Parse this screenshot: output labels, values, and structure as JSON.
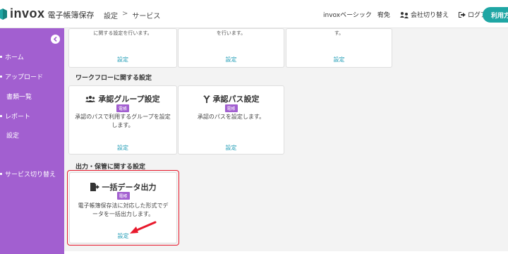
{
  "header": {
    "logo_text": "invox",
    "logo_sub": "電子帳簿保存",
    "breadcrumb": [
      "設定",
      "サービス"
    ],
    "breadcrumb_sep": ">",
    "plan": "invoxベーシック",
    "user": "宥免",
    "switch_company": "会社切り替え",
    "logout": "ログアウト",
    "use_button": "利用方法"
  },
  "sidebar": {
    "items": [
      {
        "label": "ホーム",
        "dot": true
      },
      {
        "label": "アップロード",
        "dot": true
      },
      {
        "label": "書類一覧",
        "dot": false
      },
      {
        "label": "レポート",
        "dot": true
      },
      {
        "label": "設定",
        "dot": false
      },
      {
        "label": "サービス切り替え",
        "dot": true
      }
    ]
  },
  "top_cards": [
    {
      "desc": "に関する設定を行います。",
      "link": "設定"
    },
    {
      "desc": "を行います。",
      "link": "設定"
    },
    {
      "desc": "す。",
      "link": "設定"
    }
  ],
  "workflow": {
    "heading": "ワークフローに関する設定",
    "cards": [
      {
        "title": "承認グループ設定",
        "badge": "電帳",
        "desc": "承認のパスで利用するグループを設定します。",
        "link": "設定",
        "icon": "users-icon"
      },
      {
        "title": "承認パス設定",
        "badge": "電帳",
        "desc": "承認のパスを設定します。",
        "link": "設定",
        "icon": "route-icon"
      }
    ]
  },
  "output": {
    "heading": "出力・保管に関する設定",
    "cards": [
      {
        "title": "一括データ出力",
        "badge": "電帳",
        "desc": "電子帳簿保存法に対応した形式でデータを一括出力します。",
        "link": "設定",
        "icon": "file-export-icon"
      }
    ]
  },
  "colors": {
    "sidebar": "#a25fd0",
    "accent": "#1fa6a4",
    "link": "#1e9bb5",
    "highlight": "#e8192c",
    "arrow": "#e8192c"
  }
}
